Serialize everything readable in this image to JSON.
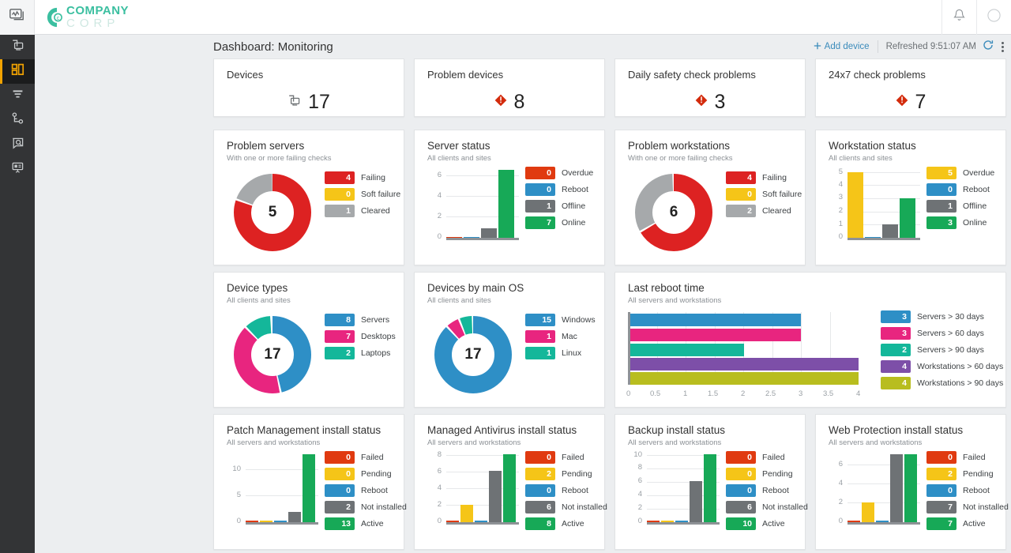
{
  "brand": {
    "line1": "COMPANY",
    "line2": "CORP",
    "color": "#3bbfa0"
  },
  "topbar": {
    "app_switcher_icon": "monitoring-app-icon",
    "notification_icon": "bell-icon"
  },
  "rail": {
    "items": [
      {
        "name": "devices",
        "icon": "devices-icon",
        "active": false
      },
      {
        "name": "dashboard",
        "icon": "dashboard-grid-icon",
        "active": true
      },
      {
        "name": "filters",
        "icon": "filter-icon",
        "active": false
      },
      {
        "name": "network-topology",
        "icon": "topology-icon",
        "active": false
      },
      {
        "name": "search-monitor",
        "icon": "monitor-search-icon",
        "active": false
      },
      {
        "name": "reports",
        "icon": "report-presentation-icon",
        "active": false
      }
    ]
  },
  "header": {
    "title": "Dashboard: Monitoring",
    "add_device_label": "Add device",
    "add_device_icon": "plus-icon",
    "refreshed_label": "Refreshed 9:51:07 AM",
    "refresh_icon": "refresh-icon",
    "more_icon": "kebab-menu-icon"
  },
  "kpis": [
    {
      "title": "Devices",
      "value": "17",
      "icon": "devices-icon",
      "icon_kind": "devices"
    },
    {
      "title": "Problem devices",
      "value": "8",
      "icon": "alert-diamond-icon",
      "icon_kind": "alert"
    },
    {
      "title": "Daily safety check problems",
      "value": "3",
      "icon": "alert-diamond-icon",
      "icon_kind": "alert"
    },
    {
      "title": "24x7 check problems",
      "value": "7",
      "icon": "alert-diamond-icon",
      "icon_kind": "alert"
    }
  ],
  "colors": {
    "red": "#dd2222",
    "red_orange": "#e03a10",
    "yellow": "#f5c518",
    "gray": "#6e7275",
    "green": "#17a957",
    "blue": "#2e8fc6",
    "pink": "#e8257f",
    "teal": "#14b79a",
    "purple": "#7d4fa8",
    "olive": "#b8bd1f",
    "accent_link": "#3a8bbb",
    "rail_active": "#f0a202"
  },
  "chart_data": [
    {
      "id": "problem-servers",
      "type": "pie",
      "title": "Problem servers",
      "subtitle": "With one or more failing checks",
      "center_value": "5",
      "legend_position": "right",
      "categories": [
        "Failing",
        "Soft failure",
        "Cleared"
      ],
      "values": [
        4,
        0,
        1
      ],
      "colors": [
        "#dd2222",
        "#f5c518",
        "#a6a9ab"
      ]
    },
    {
      "id": "server-status",
      "type": "bar",
      "title": "Server status",
      "subtitle": "All clients and sites",
      "legend_position": "right",
      "categories": [
        "Overdue",
        "Reboot",
        "Offline",
        "Online"
      ],
      "values": [
        0,
        0,
        1,
        7
      ],
      "colors": [
        "#e03a10",
        "#2e8fc6",
        "#6e7275",
        "#17a957"
      ],
      "yticks": [
        0,
        2,
        4,
        6
      ],
      "ylim": [
        0,
        7.4
      ],
      "grid": true
    },
    {
      "id": "problem-workstations",
      "type": "pie",
      "title": "Problem workstations",
      "subtitle": "With one or more failing checks",
      "center_value": "6",
      "legend_position": "right",
      "categories": [
        "Failing",
        "Soft failure",
        "Cleared"
      ],
      "values": [
        4,
        0,
        2
      ],
      "colors": [
        "#dd2222",
        "#f5c518",
        "#a6a9ab"
      ]
    },
    {
      "id": "workstation-status",
      "type": "bar",
      "title": "Workstation status",
      "subtitle": "All clients and sites",
      "legend_position": "right",
      "categories": [
        "Overdue",
        "Reboot",
        "Offline",
        "Online"
      ],
      "values": [
        5,
        0,
        1,
        3
      ],
      "colors": [
        "#f5c518",
        "#2e8fc6",
        "#6e7275",
        "#17a957"
      ],
      "yticks": [
        0,
        1,
        2,
        3,
        4,
        5
      ],
      "ylim": [
        0,
        5
      ],
      "grid": true
    },
    {
      "id": "device-types",
      "type": "pie",
      "title": "Device types",
      "subtitle": "All clients and sites",
      "center_value": "17",
      "legend_position": "right",
      "categories": [
        "Servers",
        "Desktops",
        "Laptops"
      ],
      "values": [
        8,
        7,
        2
      ],
      "colors": [
        "#2e8fc6",
        "#e8257f",
        "#14b79a"
      ]
    },
    {
      "id": "devices-by-main-os",
      "type": "pie",
      "title": "Devices by main OS",
      "subtitle": "All clients and sites",
      "center_value": "17",
      "legend_position": "right",
      "categories": [
        "Windows",
        "Mac",
        "Linux"
      ],
      "values": [
        15,
        1,
        1
      ],
      "colors": [
        "#2e8fc6",
        "#e8257f",
        "#14b79a"
      ]
    },
    {
      "id": "last-reboot-time",
      "type": "bar",
      "orientation": "horizontal",
      "title": "Last reboot time",
      "subtitle": "All servers and workstations",
      "legend_position": "right",
      "categories": [
        "Servers > 30 days",
        "Servers > 60 days",
        "Servers > 90 days",
        "Workstations > 60 days",
        "Workstations > 90 days"
      ],
      "values": [
        3,
        3,
        2,
        4,
        4
      ],
      "colors": [
        "#2e8fc6",
        "#e8257f",
        "#14b79a",
        "#7d4fa8",
        "#b8bd1f"
      ],
      "xticks": [
        "0",
        "0.5",
        "1",
        "1.5",
        "2",
        "2.5",
        "3",
        "3.5",
        "4"
      ],
      "xlim": [
        0,
        4
      ],
      "grid": true
    },
    {
      "id": "patch-management-install-status",
      "type": "bar",
      "title": "Patch Management install status",
      "subtitle": "All servers and workstations",
      "legend_position": "right",
      "categories": [
        "Failed",
        "Pending",
        "Reboot",
        "Not installed",
        "Active"
      ],
      "values": [
        0,
        0,
        0,
        2,
        13
      ],
      "colors": [
        "#e03a10",
        "#f5c518",
        "#2e8fc6",
        "#6e7275",
        "#17a957"
      ],
      "yticks": [
        0,
        5,
        10
      ],
      "ylim": [
        0,
        13
      ],
      "grid": true
    },
    {
      "id": "managed-antivirus-install-status",
      "type": "bar",
      "title": "Managed Antivirus install status",
      "subtitle": "All servers and workstations",
      "legend_position": "right",
      "categories": [
        "Failed",
        "Pending",
        "Reboot",
        "Not installed",
        "Active"
      ],
      "values": [
        0,
        2,
        0,
        6,
        8
      ],
      "colors": [
        "#e03a10",
        "#f5c518",
        "#2e8fc6",
        "#6e7275",
        "#17a957"
      ],
      "yticks": [
        0,
        2,
        4,
        6,
        8
      ],
      "ylim": [
        0,
        8
      ],
      "grid": true
    },
    {
      "id": "backup-install-status",
      "type": "bar",
      "title": "Backup install status",
      "subtitle": "All servers and workstations",
      "legend_position": "right",
      "categories": [
        "Failed",
        "Pending",
        "Reboot",
        "Not installed",
        "Active"
      ],
      "values": [
        0,
        0,
        0,
        6,
        10
      ],
      "colors": [
        "#e03a10",
        "#f5c518",
        "#2e8fc6",
        "#6e7275",
        "#17a957"
      ],
      "yticks": [
        0,
        2,
        4,
        6,
        8,
        10
      ],
      "ylim": [
        0,
        10
      ],
      "grid": true
    },
    {
      "id": "web-protection-install-status",
      "type": "bar",
      "title": "Web Protection install status",
      "subtitle": "All servers and workstations",
      "legend_position": "right",
      "categories": [
        "Failed",
        "Pending",
        "Reboot",
        "Not installed",
        "Active"
      ],
      "values": [
        0,
        2,
        0,
        7,
        7
      ],
      "colors": [
        "#e03a10",
        "#f5c518",
        "#2e8fc6",
        "#6e7275",
        "#17a957"
      ],
      "yticks": [
        0,
        2,
        4,
        6
      ],
      "ylim": [
        0,
        7
      ],
      "grid": true
    }
  ]
}
